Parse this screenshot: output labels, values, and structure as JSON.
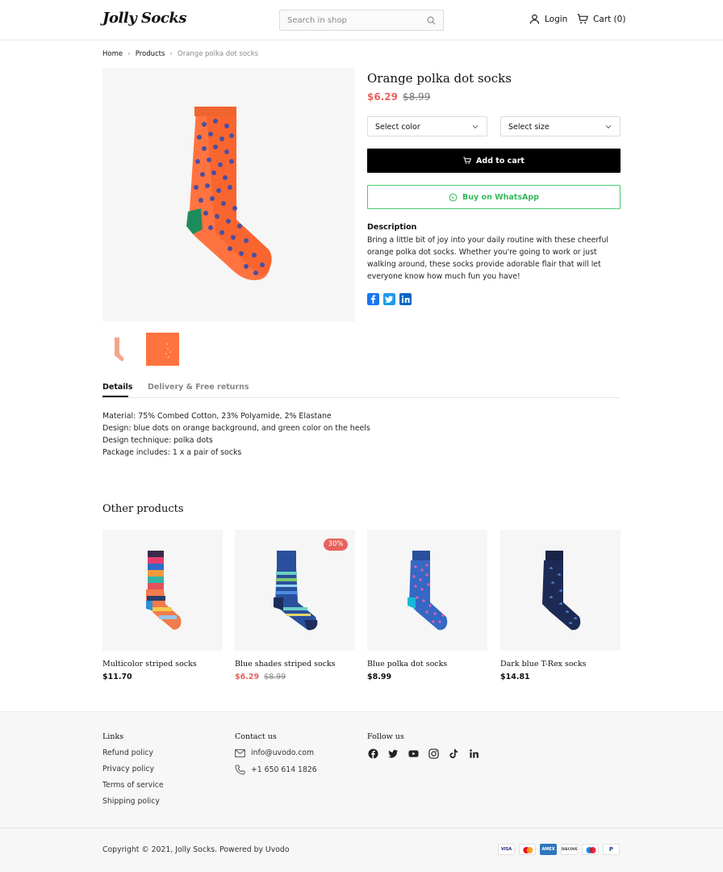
{
  "header": {
    "logo_text": "Jolly Socks",
    "search_placeholder": "Search in shop",
    "login_label": "Login",
    "cart_label": "Cart (0)"
  },
  "breadcrumb": [
    "Home",
    "Products",
    "Orange polka dot socks"
  ],
  "product": {
    "title": "Orange polka dot socks",
    "price": "$6.29",
    "old_price": "$8.99",
    "select_color": "Select color",
    "select_size": "Select size",
    "add_to_cart": "Add to cart",
    "buy_whatsapp": "Buy on WhatsApp",
    "description_title": "Description",
    "description": "Bring a little bit of joy into your daily routine with these cheerful orange polka dot socks. Whether you're going to work or just walking around, these socks provide adorable flair that will let everyone know how much fun you have!",
    "share_icons": [
      "facebook-icon",
      "twitter-icon",
      "linkedin-icon"
    ]
  },
  "tabs": [
    "Details",
    "Delivery & Free returns"
  ],
  "details": [
    "Material: 75% Combed Cotton, 23% Polyamide, 2% Elastane",
    "Design: blue dots on orange background, and green color on the heels",
    "Design technique: polka dots",
    "Package includes: 1 x a pair of socks"
  ],
  "other_products": {
    "title": "Other products",
    "items": [
      {
        "name": "Multicolor striped socks",
        "price": "$11.70"
      },
      {
        "name": "Blue shades striped socks",
        "price": "$6.29",
        "old_price": "$8.99",
        "badge": "30%"
      },
      {
        "name": "Blue polka dot socks",
        "price": "$8.99"
      },
      {
        "name": "Dark blue T-Rex socks",
        "price": "$14.81"
      }
    ]
  },
  "footer": {
    "links_title": "Links",
    "links": [
      "Refund policy",
      "Privacy policy",
      "Terms of service",
      "Shipping policy"
    ],
    "contact_title": "Contact us",
    "email": "info@uvodo.com",
    "phone": "+1 650 614 1826",
    "follow_title": "Follow us",
    "social_icons": [
      "facebook-icon",
      "twitter-icon",
      "youtube-icon",
      "instagram-icon",
      "tiktok-icon",
      "linkedin-icon"
    ],
    "copyright": "Copyright © 2021, Jolly Socks. Powered by Uvodo",
    "payments": [
      "VISA",
      "mastercard",
      "AMEX",
      "DISCOVER",
      "maestro",
      "P"
    ]
  },
  "colors": {
    "accent_price": "#e8625c",
    "whatsapp": "#35b85a",
    "social_blue": "#1877f2"
  }
}
